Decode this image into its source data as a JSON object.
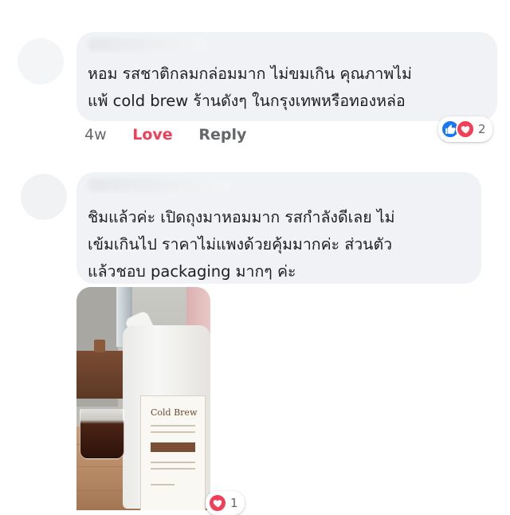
{
  "comments": [
    {
      "text": "หอม รสชาติกลมกล่อมมาก ไม่ขมเกิน คุณภาพไม่\nแพ้ cold brew ร้านดังๆ ในกรุงเทพหรือทองหล่อ",
      "actions": {
        "time": "4w",
        "love": "Love",
        "reply": "Reply"
      },
      "reactions": {
        "icons": [
          "like-icon",
          "love-icon"
        ],
        "count": "2"
      }
    },
    {
      "text": "ชิมแล้วค่ะ เปิดถุงมาหอมมาก รสกำลังดีเลย ไม่\nเข้มเกินไป ราคาไม่แพงด้วยคุ้มมากค่ะ ส่วนตัว\nแล้วชอบ packaging มากๆ ค่ะ",
      "photo": {
        "product_title": "Cold Brew"
      },
      "reactions": {
        "icons": [
          "love-icon"
        ],
        "count": "1"
      }
    }
  ],
  "colors": {
    "bubble": "#f0f2f5",
    "love": "#f33e58",
    "like": "#1877f2",
    "meta": "#65676b"
  }
}
